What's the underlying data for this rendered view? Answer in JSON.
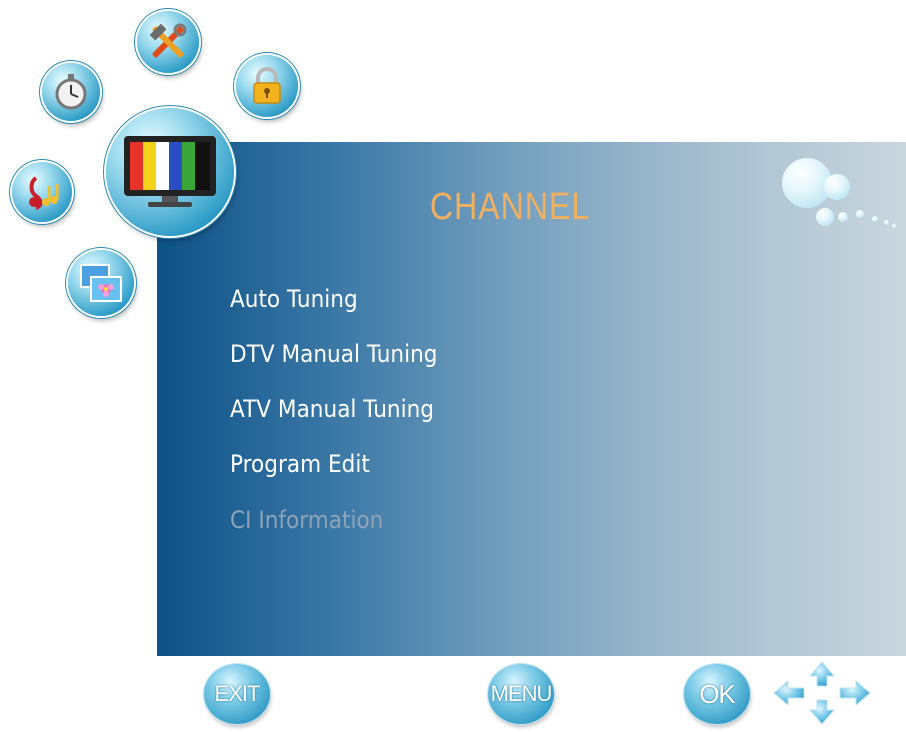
{
  "menu": {
    "title": "CHANNEL",
    "items": [
      {
        "label": "Auto Tuning",
        "enabled": true
      },
      {
        "label": "DTV Manual Tuning",
        "enabled": true
      },
      {
        "label": "ATV Manual Tuning",
        "enabled": true
      },
      {
        "label": "Program Edit",
        "enabled": true
      },
      {
        "label": "CI Information",
        "enabled": false
      }
    ]
  },
  "categories": [
    {
      "name": "setup",
      "icon": "tools-icon"
    },
    {
      "name": "time",
      "icon": "clock-icon"
    },
    {
      "name": "lock",
      "icon": "lock-icon"
    },
    {
      "name": "channel",
      "icon": "tv-icon",
      "selected": true
    },
    {
      "name": "sound",
      "icon": "music-icon"
    },
    {
      "name": "picture",
      "icon": "photo-icon"
    }
  ],
  "footer": {
    "exit_label": "EXIT",
    "menu_label": "MENU",
    "ok_label": "OK"
  },
  "colors": {
    "title": "#f0b060",
    "panel_start": "#0d5187",
    "panel_end": "#c9d6de",
    "disabled_text": "#8fa3b8"
  }
}
